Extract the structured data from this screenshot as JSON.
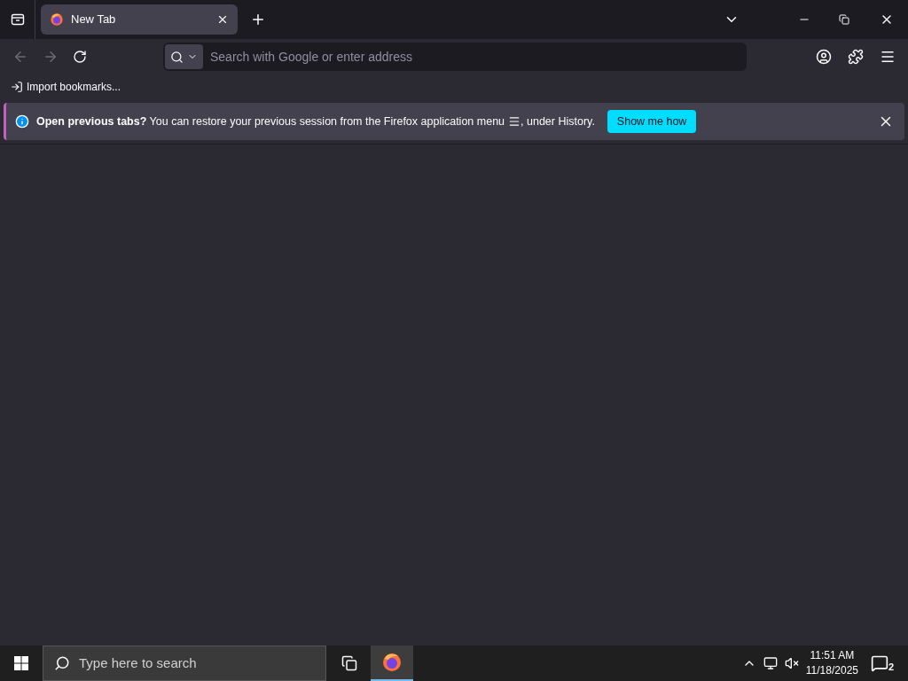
{
  "tabs": [
    {
      "title": "New Tab",
      "selected": true
    }
  ],
  "navigation": {
    "back_disabled": true,
    "forward_disabled": true
  },
  "address_bar": {
    "placeholder": "Search with Google or enter address"
  },
  "bookmarks": [
    {
      "label": "Import bookmarks..."
    }
  ],
  "notification": {
    "message": "**Open previous tabs?** You can restore your previous session from the Firefox application menu",
    "message_end": ", under History.",
    "button": "Show me how"
  },
  "taskbar": {
    "search_placeholder": "Type here to search",
    "apps": [
      {
        "selected": true
      }
    ],
    "time": "11:51 AM",
    "date": "11/18/2025",
    "notification_count": "2"
  }
}
